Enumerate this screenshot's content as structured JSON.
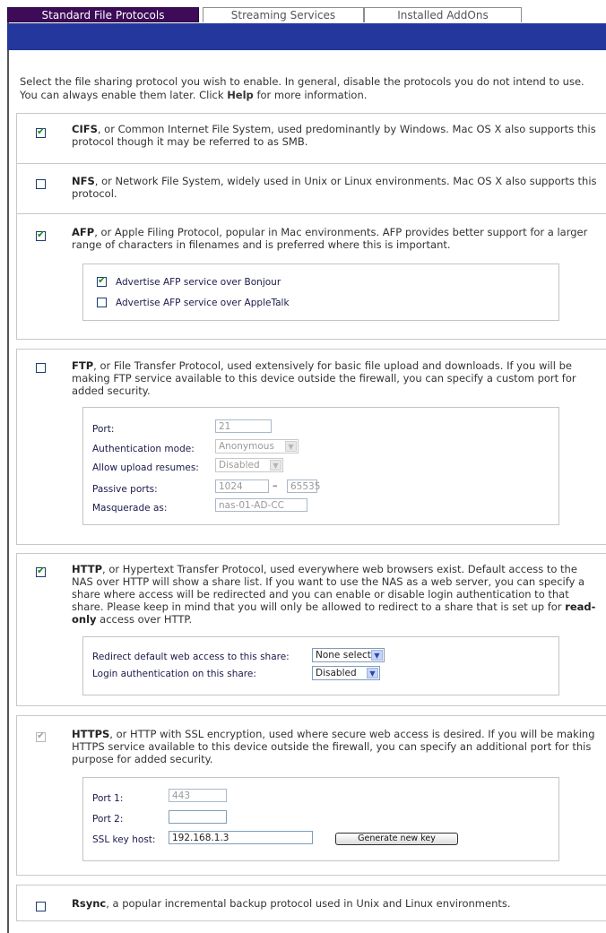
{
  "tabs": [
    {
      "label": "Standard File Protocols",
      "active": true
    },
    {
      "label": "Streaming Services",
      "active": false
    },
    {
      "label": "Installed AddOns",
      "active": false
    }
  ],
  "intro": {
    "pre": "Select the file sharing protocol you wish to enable. In general, disable the protocols you do not intend to use. You can always enable them later. Click ",
    "bold": "Help",
    "post": " for more information."
  },
  "cifs": {
    "checked": true,
    "name": "CIFS",
    "text": ", or Common Internet File System, used predominantly by Windows. Mac OS X also supports this protocol though it may be referred to as SMB."
  },
  "nfs": {
    "checked": false,
    "name": "NFS",
    "text": ", or Network File System, widely used in Unix or Linux environments. Mac OS X also supports this protocol."
  },
  "afp": {
    "checked": true,
    "name": "AFP",
    "text": ", or Apple Filing Protocol, popular in Mac environments. AFP provides better support for a larger range of characters in filenames and is preferred where this is important.",
    "options": [
      {
        "label": "Advertise AFP service over Bonjour",
        "checked": true
      },
      {
        "label": "Advertise AFP service over AppleTalk",
        "checked": false
      }
    ]
  },
  "ftp": {
    "checked": false,
    "name": "FTP",
    "text": ", or File Transfer Protocol, used extensively for basic file upload and downloads. If you will be making FTP service available to this device outside the firewall, you can specify a custom port for added security.",
    "port_label": "Port:",
    "port_value": "21",
    "auth_label": "Authentication mode:",
    "auth_value": "Anonymous",
    "resume_label": "Allow upload resumes:",
    "resume_value": "Disabled",
    "passive_label": "Passive ports:",
    "passive_from": "1024",
    "passive_sep": "–",
    "passive_to": "65535",
    "masq_label": "Masquerade as:",
    "masq_value": "nas-01-AD-CC"
  },
  "http": {
    "checked": true,
    "name": "HTTP",
    "text_pre": ", or Hypertext Transfer Protocol, used everywhere web browsers exist. Default access to the NAS over HTTP will show a share list. If you want to use the NAS as a web server, you can specify a share where access will be redirected and you can enable or disable login authentication to that share. Please keep in mind that you will only be allowed to redirect to a share that is set up for ",
    "text_bold": "read-only",
    "text_post": " access over HTTP.",
    "redirect_label": "Redirect default web access to this share:",
    "redirect_value": "None selected",
    "login_label": "Login authentication on this share:",
    "login_value": "Disabled"
  },
  "https": {
    "checked": true,
    "disabled": true,
    "name": "HTTPS",
    "text": ", or HTTP with SSL encryption, used where secure web access is desired. If you will be making HTTPS service available to this device outside the firewall, you can specify an additional port for this purpose for added security.",
    "port1_label": "Port 1:",
    "port1_value": "443",
    "port2_label": "Port 2:",
    "port2_value": "",
    "ssl_label": "SSL key host:",
    "ssl_value": "192.168.1.3",
    "generate_label": "Generate new key"
  },
  "rsync": {
    "checked": false,
    "name": "Rsync",
    "text": ", a popular incremental backup protocol used in Unix and Linux environments."
  },
  "colors": {
    "active_tab": "#3d0b57",
    "header_bar": "#23379c",
    "check_green": "#1f8a1f"
  }
}
